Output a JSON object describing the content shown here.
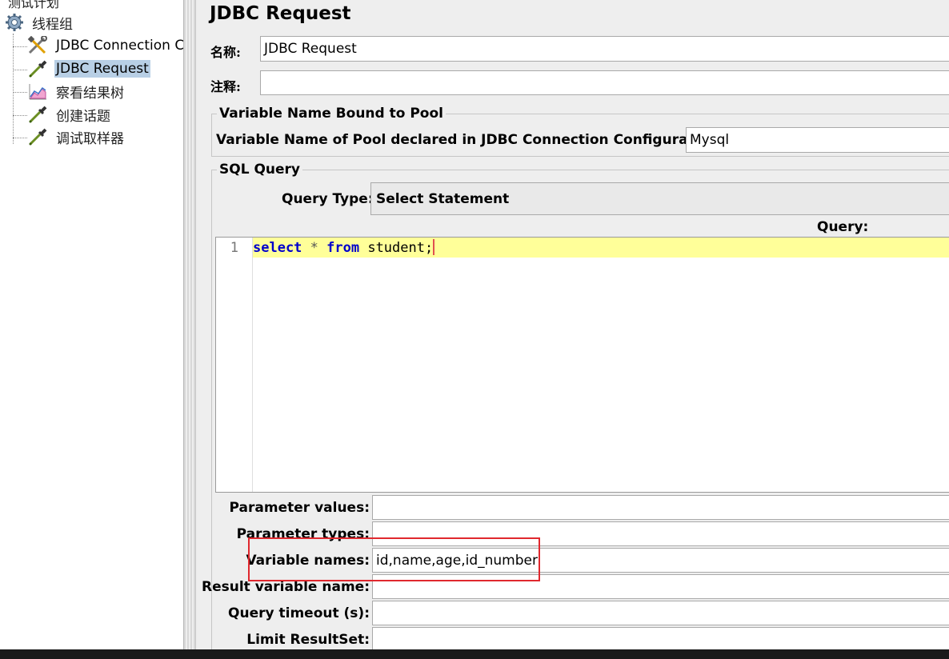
{
  "tree": {
    "top_label": "测试计划",
    "thread_group": "线程组",
    "items": [
      {
        "label": "JDBC Connection C",
        "icon": "wrench-screwdriver-icon",
        "selected": false
      },
      {
        "label": "JDBC Request",
        "icon": "pipette-icon",
        "selected": true
      },
      {
        "label": "察看结果树",
        "icon": "chart-icon",
        "selected": false
      },
      {
        "label": "创建话题",
        "icon": "pipette-icon",
        "selected": false
      },
      {
        "label": "调试取样器",
        "icon": "pipette-icon",
        "selected": false
      }
    ]
  },
  "main": {
    "title": "JDBC Request",
    "name_label": "名称:",
    "name_value": "JDBC Request",
    "comment_label": "注释:",
    "comment_value": "",
    "pool_group_title": "Variable Name Bound to Pool",
    "pool_label": "Variable Name of Pool declared in JDBC Connection Configuration:",
    "pool_value": "Mysql",
    "sql_group_title": "SQL Query",
    "query_type_label": "Query Type:",
    "query_type_value": "Select Statement",
    "query_label": "Query:",
    "editor": {
      "line_number": "1",
      "kw_select": "select",
      "star": " * ",
      "kw_from": "from",
      "rest": " student;"
    },
    "param_values_label": "Parameter values:",
    "param_values_value": "",
    "param_types_label": "Parameter types:",
    "param_types_value": "",
    "var_names_label": "Variable names:",
    "var_names_value": "id,name,age,id_number",
    "result_var_label": "Result variable name:",
    "result_var_value": "",
    "timeout_label": "Query timeout (s):",
    "timeout_value": "",
    "limit_label": "Limit ResultSet:",
    "limit_value": ""
  },
  "colors": {
    "selection": "#b8cfe5",
    "current_line": "#ffff99",
    "highlight_box": "#e0282e",
    "keyword": "#0000cc"
  }
}
